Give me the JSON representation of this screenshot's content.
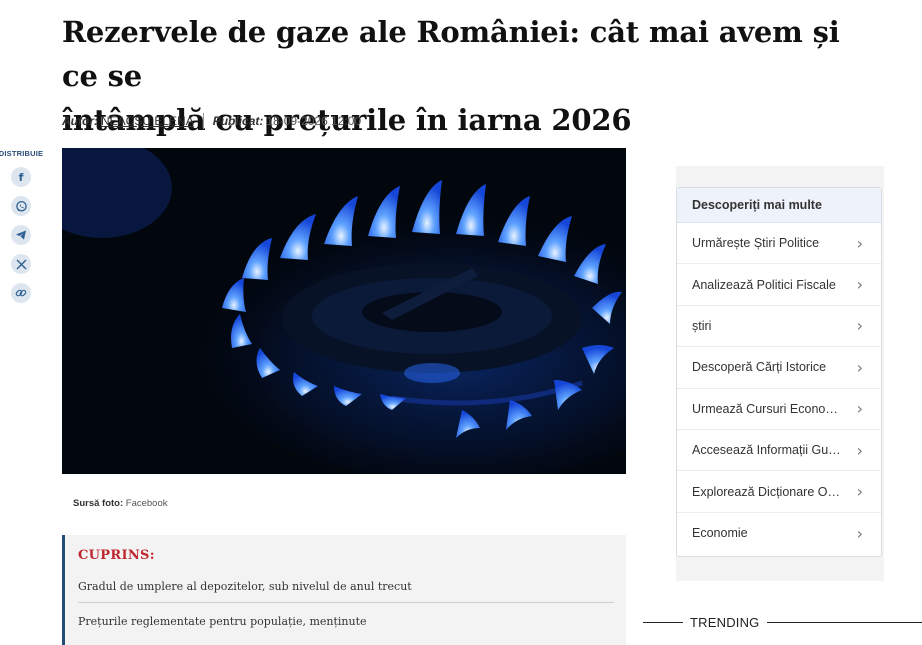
{
  "article": {
    "title_line1": "Rezervele de gaze ale României: cât mai avem și ce se",
    "title_line2": "întâmplă cu prețurile în iarna 2026",
    "author_label": "Autor:",
    "author_name": "NEACȘU ELENA",
    "published_label": "Publicat:",
    "published_date": "18-09-2026 12:00",
    "photo_alt": "Gas stove burner with blue flames",
    "photo_source_label": "Sursă foto:",
    "photo_source": "Facebook"
  },
  "share": {
    "label": "DISTRIBUIE",
    "buttons": [
      {
        "icon": "facebook-icon",
        "glyph": "f"
      },
      {
        "icon": "whatsapp-icon",
        "glyph": "✆"
      },
      {
        "icon": "telegram-icon",
        "glyph": "➤"
      },
      {
        "icon": "x-icon",
        "glyph": "𝕏"
      },
      {
        "icon": "link-icon",
        "glyph": "🔗"
      }
    ]
  },
  "toc": {
    "title": "CUPRINS:",
    "items": [
      "Gradul de umplere al depozitelor, sub nivelul de anul trecut",
      "Prețurile reglementate pentru populație, menținute"
    ]
  },
  "discover": {
    "title": "Descoperiți mai multe",
    "items": [
      "Urmărește Știri Politice",
      "Analizează Politici Fiscale",
      "știri",
      "Descoperă Cărți Istorice",
      "Urmează Cursuri Economice",
      "Accesează Informații Guvernamentale",
      "Explorează Dicționare Online",
      "Economie"
    ],
    "chevron": "›"
  },
  "trending": {
    "label": "TRENDING"
  },
  "colors": {
    "toc_accent": "#c0262d",
    "toc_border": "#274b78",
    "share_icon": "#2b5f93",
    "flame_blue": "#1e6bff"
  }
}
